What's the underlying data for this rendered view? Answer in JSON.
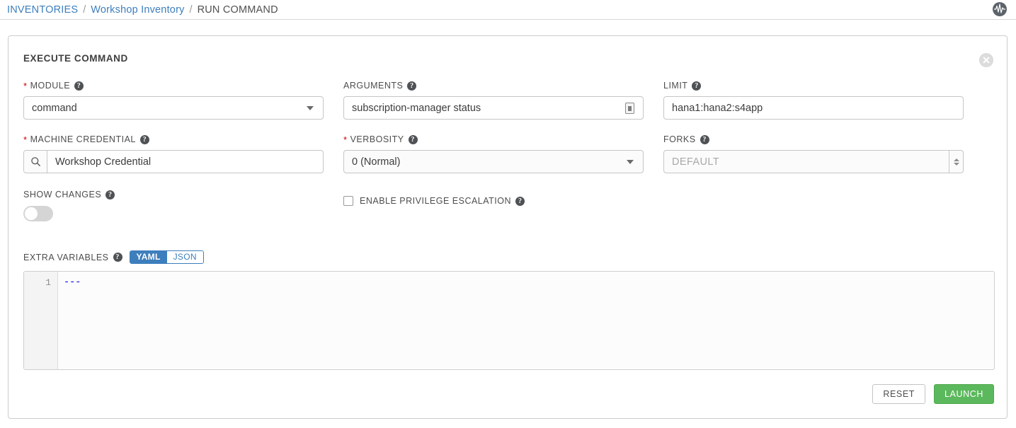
{
  "breadcrumb": {
    "items": [
      {
        "label": "INVENTORIES",
        "link": true
      },
      {
        "label": "Workshop Inventory",
        "link": true
      },
      {
        "label": "RUN COMMAND",
        "link": false
      }
    ],
    "separator": "/"
  },
  "header": {
    "activity_icon": "activity-pulse-icon"
  },
  "card": {
    "title": "EXECUTE COMMAND",
    "close_icon": "close-icon"
  },
  "fields": {
    "module": {
      "label": "MODULE",
      "required": true,
      "value": "command",
      "help_icon": "help-icon",
      "caret_icon": "chevron-down-icon"
    },
    "arguments": {
      "label": "ARGUMENTS",
      "required": false,
      "value": "subscription-manager status",
      "help_icon": "help-icon",
      "prompt_icon": "prompt-on-launch-icon"
    },
    "limit": {
      "label": "LIMIT",
      "required": false,
      "value": "hana1:hana2:s4app",
      "help_icon": "help-icon"
    },
    "machine_credential": {
      "label": "MACHINE CREDENTIAL",
      "required": true,
      "value": "Workshop Credential",
      "help_icon": "help-icon",
      "search_icon": "search-icon"
    },
    "verbosity": {
      "label": "VERBOSITY",
      "required": true,
      "value": "0 (Normal)",
      "help_icon": "help-icon",
      "caret_icon": "chevron-down-icon"
    },
    "forks": {
      "label": "FORKS",
      "required": false,
      "value": "",
      "placeholder": "DEFAULT",
      "help_icon": "help-icon",
      "spinner_icon": "number-spinner-icon"
    },
    "show_changes": {
      "label": "SHOW CHANGES",
      "help_icon": "help-icon",
      "state": "off"
    },
    "enable_privilege_escalation": {
      "label": "ENABLE PRIVILEGE ESCALATION",
      "help_icon": "help-icon",
      "checked": false
    },
    "extra_variables": {
      "label": "EXTRA VARIABLES",
      "help_icon": "help-icon",
      "format_options": [
        {
          "label": "YAML",
          "active": true
        },
        {
          "label": "JSON",
          "active": false
        }
      ],
      "line_numbers": [
        "1"
      ],
      "content": "---"
    }
  },
  "actions": {
    "reset_label": "RESET",
    "launch_label": "LAUNCH"
  },
  "colors": {
    "link": "#3d7ebd",
    "required_star": "#cc0000",
    "launch_green": "#5cb85c",
    "yaml_active": "#3d7ebd",
    "code_blue": "#0000ee"
  }
}
